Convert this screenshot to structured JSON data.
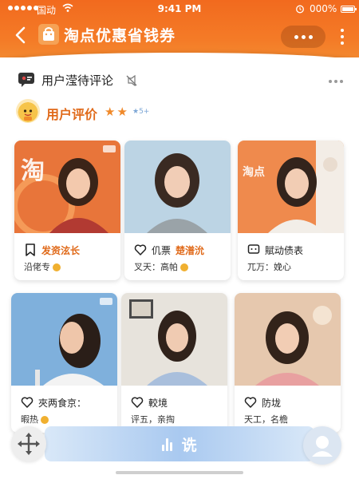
{
  "status_bar": {
    "carrier": "国动",
    "time": "9:41 PM",
    "battery": "000%"
  },
  "header": {
    "title": "淘点优惠省钱券",
    "icons": [
      "back-icon",
      "shop-bag-icon",
      "more-icon",
      "vertical-more-icon"
    ]
  },
  "section": {
    "title": "用户滢待评论",
    "icons": [
      "chat-icon",
      "mute-icon",
      "more-icon"
    ]
  },
  "reviews": {
    "title": "用户评价",
    "stars": "★★",
    "star_note": "★5+"
  },
  "cards": [
    {
      "icon": "bookmark-icon",
      "line1": "发资泫长",
      "line2": "沿佬专",
      "line1_color": "#e06a1a",
      "photo_bg": "#e8753a",
      "emoji": true
    },
    {
      "icon": "heart-icon",
      "line1_prefix": "仉票",
      "line1": "楚潽沇",
      "line2": "叉天：高帕",
      "line1_color": "#e06a1a",
      "photo_bg": "#bcd4e4",
      "emoji": true
    },
    {
      "icon": "message-icon",
      "line1": "賦动债表",
      "line2": "兀万：娩心",
      "line1_color": "#222222",
      "photo_bg": "#ef8a4d",
      "emoji": false
    },
    {
      "icon": "heart-icon",
      "line1": "夾两食京：",
      "line2": "暇热",
      "line1_color": "#222222",
      "photo_bg": "#7fb0dc",
      "emoji": true
    },
    {
      "icon": "heart-icon",
      "line1": "較境",
      "line2": "评五，亲掏",
      "line1_color": "#222222",
      "photo_bg": "#e7e3dc",
      "emoji": false
    },
    {
      "icon": "heart-icon",
      "line1": "防垅",
      "line2": "天工，名檐",
      "line1_color": "#222222",
      "photo_bg": "#e6c8ae",
      "emoji": false
    }
  ],
  "bottom": {
    "voice_label": "诜",
    "icons": [
      "move-icon",
      "voice-icon",
      "avatar-icon"
    ]
  },
  "colors": {
    "accent": "#f26a1e",
    "accent_text": "#e06a1a",
    "voice_bar": "#a9c9f0"
  }
}
